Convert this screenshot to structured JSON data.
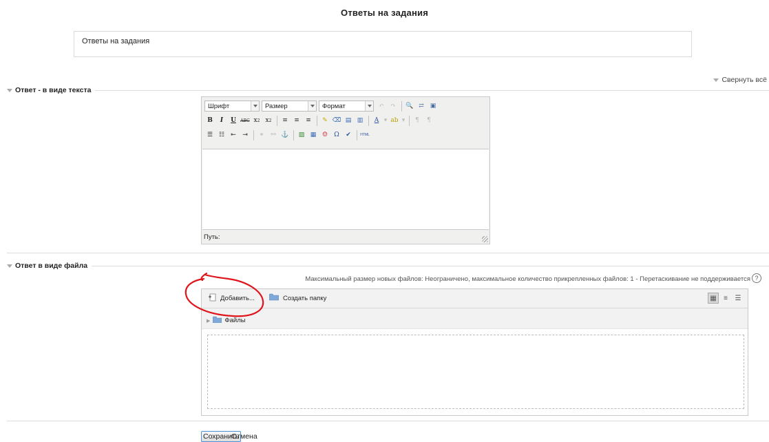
{
  "page": {
    "title": "Ответы на задания",
    "intro_text": "Ответы на задания"
  },
  "collapse_all_label": "Свернуть всё",
  "sections": {
    "text": {
      "legend": "Ответ - в виде текста"
    },
    "file": {
      "legend": "Ответ в виде файла"
    }
  },
  "editor": {
    "font_select": "Шрифт",
    "size_select": "Размер",
    "format_select": "Формат",
    "path_label": "Путь:"
  },
  "filemanager": {
    "info": "Максимальный размер новых файлов: Неограничено, максимальное количество прикрепленных файлов: 1 - Перетаскивание не поддерживается",
    "add_button": "Добавить...",
    "create_folder_button": "Создать папку",
    "root_folder": "Файлы"
  },
  "buttons": {
    "save": "Сохранить",
    "cancel": "Отмена"
  },
  "colors": {
    "annotation": "#e0141b",
    "folder": "#7fa9d8",
    "save_border": "#4a90d9"
  }
}
